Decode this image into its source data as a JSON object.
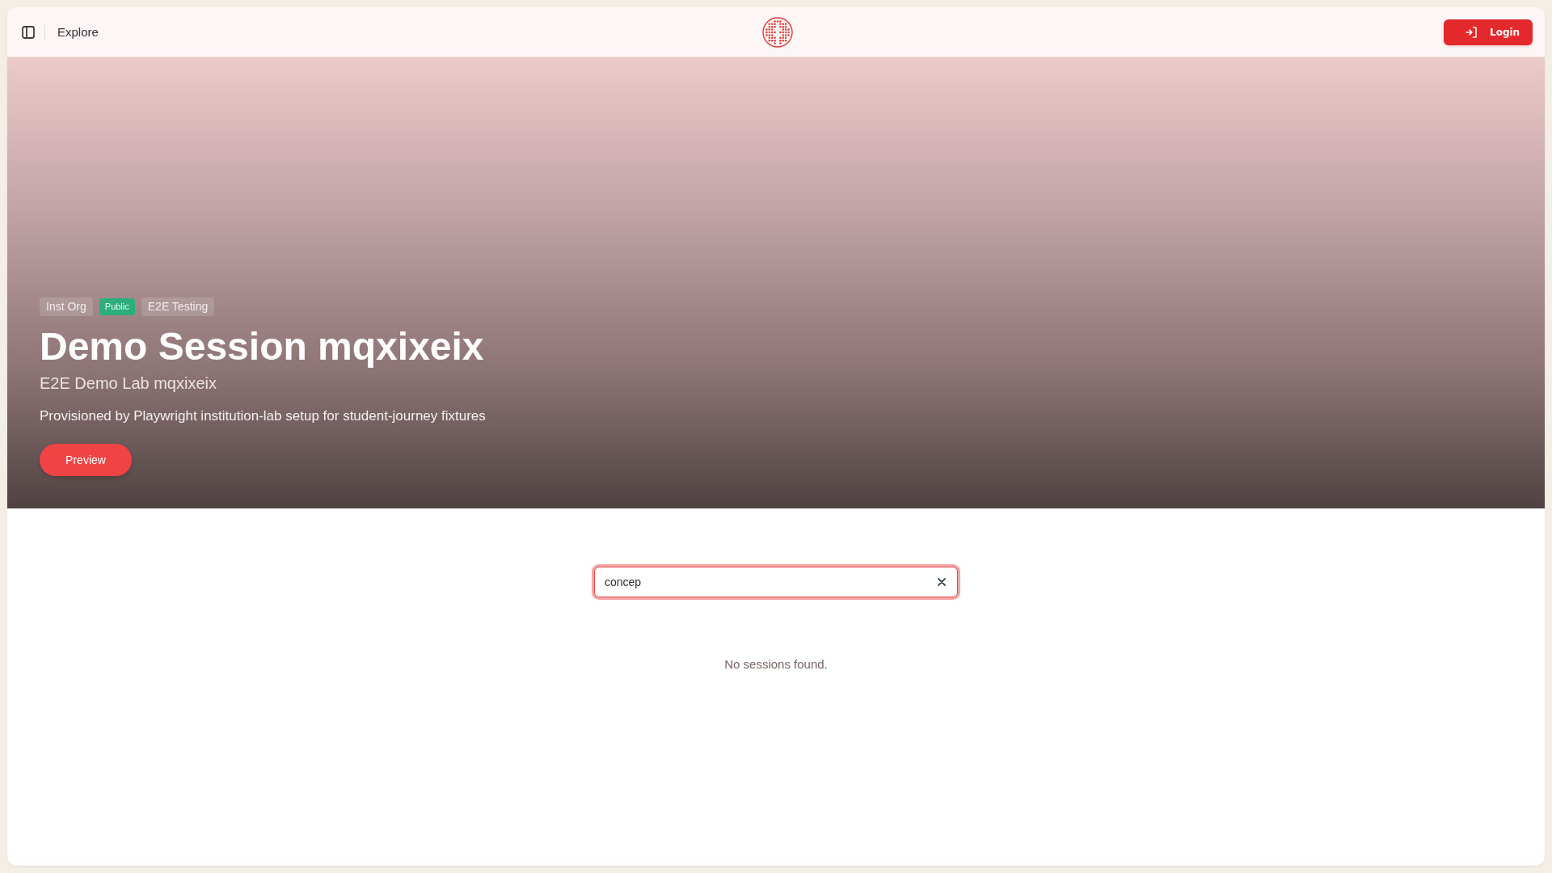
{
  "header": {
    "nav_label": "Explore",
    "login_button": "Login"
  },
  "hero": {
    "tags": [
      {
        "label": "Inst Org",
        "kind": "plain"
      },
      {
        "label": "Public",
        "kind": "visibility"
      },
      {
        "label": "E2E Testing",
        "kind": "plain"
      }
    ],
    "title": "Demo Session mqxixeix",
    "subtitle": "E2E Demo Lab mqxixeix",
    "description": "Provisioned by Playwright institution-lab setup for student-journey fixtures",
    "preview_button": "Preview"
  },
  "search": {
    "value": "concep",
    "focused": true
  },
  "empty_message": "No sessions found."
}
